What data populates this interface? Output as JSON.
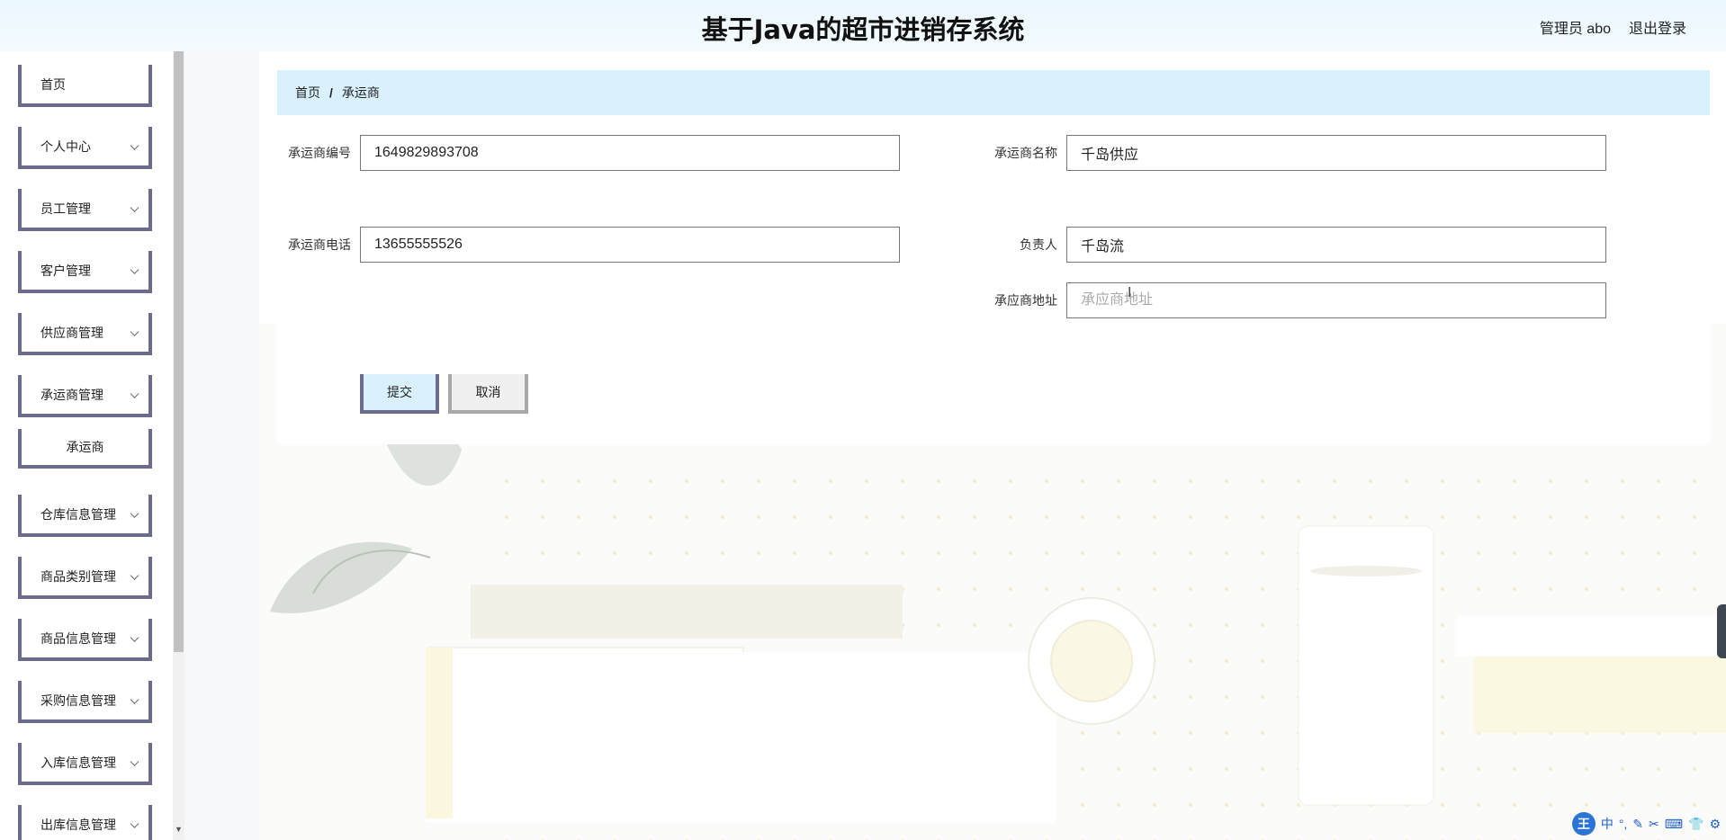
{
  "header": {
    "title": "基于Java的超市进销存系统",
    "user": "管理员 abo",
    "logout": "退出登录"
  },
  "sidebar": {
    "items": [
      {
        "label": "首页"
      },
      {
        "label": "个人中心"
      },
      {
        "label": "员工管理"
      },
      {
        "label": "客户管理"
      },
      {
        "label": "供应商管理"
      },
      {
        "label": "承运商管理",
        "expanded": true
      },
      {
        "label": "仓库信息管理"
      },
      {
        "label": "商品类别管理"
      },
      {
        "label": "商品信息管理"
      },
      {
        "label": "采购信息管理"
      },
      {
        "label": "入库信息管理"
      },
      {
        "label": "出库信息管理"
      }
    ],
    "subitem": "承运商"
  },
  "breadcrumb": {
    "home": "首页",
    "separator": "/",
    "current": "承运商"
  },
  "form": {
    "carrier_no_label": "承运商编号",
    "carrier_no_value": "1649829893708",
    "carrier_name_label": "承运商名称",
    "carrier_name_value": "千岛供应",
    "carrier_phone_label": "承运商电话",
    "carrier_phone_value": "13655555526",
    "manager_label": "负责人",
    "manager_value": "千岛流",
    "address_label": "承应商地址",
    "address_placeholder": "承应商地址",
    "submit": "提交",
    "cancel": "取消"
  },
  "ime": {
    "logo": "王",
    "mode": "中",
    "icons": [
      "punctuation-icon",
      "pen-icon",
      "scissors-icon",
      "keyboard-icon",
      "shirt-icon",
      "gear-icon"
    ]
  },
  "colors": {
    "accent_border": "#6c6b8e",
    "breadcrumb_bg": "#d8f1fc",
    "header_bg": "#eaf7fd"
  }
}
